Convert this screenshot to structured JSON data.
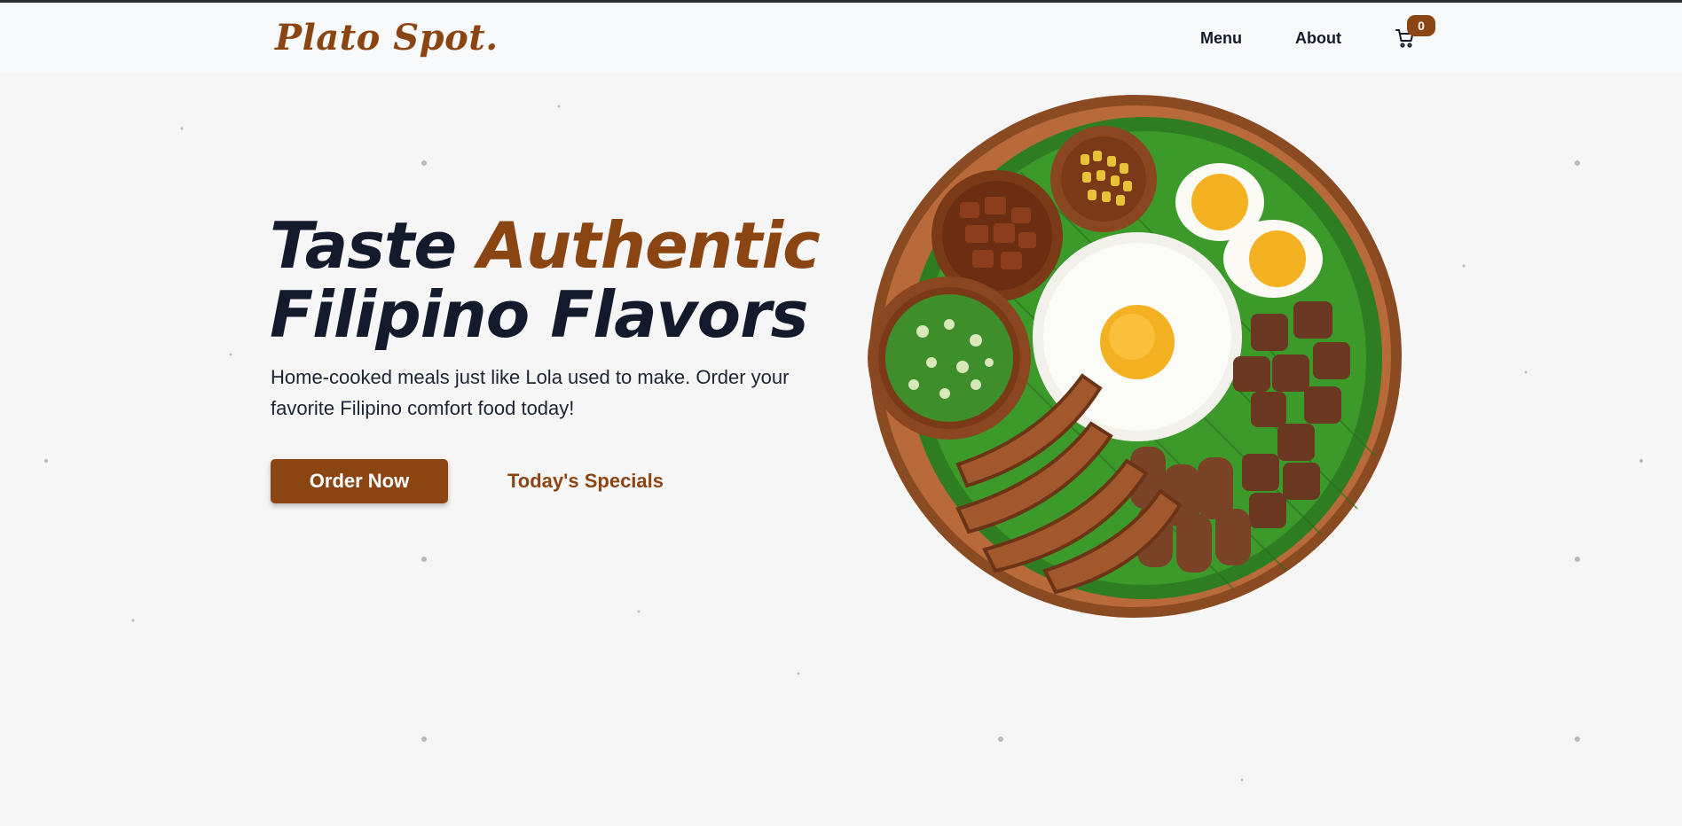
{
  "brand": {
    "name": "Plato Spot.",
    "color": "#8b4513"
  },
  "nav": {
    "items": [
      "Menu",
      "About"
    ],
    "cart_count": "0"
  },
  "hero": {
    "title_prefix": "Taste ",
    "title_accent": "Authentic",
    "title_line2": "Filipino Flavors",
    "subtitle": "Home-cooked meals just like Lola used to make. Order your favorite Filipino comfort food today!",
    "primary_cta": "Order Now",
    "secondary_cta": "Today's Specials"
  },
  "image": {
    "alt": "plate-of-filipino-silog-icon"
  },
  "colors": {
    "accent": "#8b4513",
    "text": "#121a2b",
    "background": "#f6f6f6"
  }
}
